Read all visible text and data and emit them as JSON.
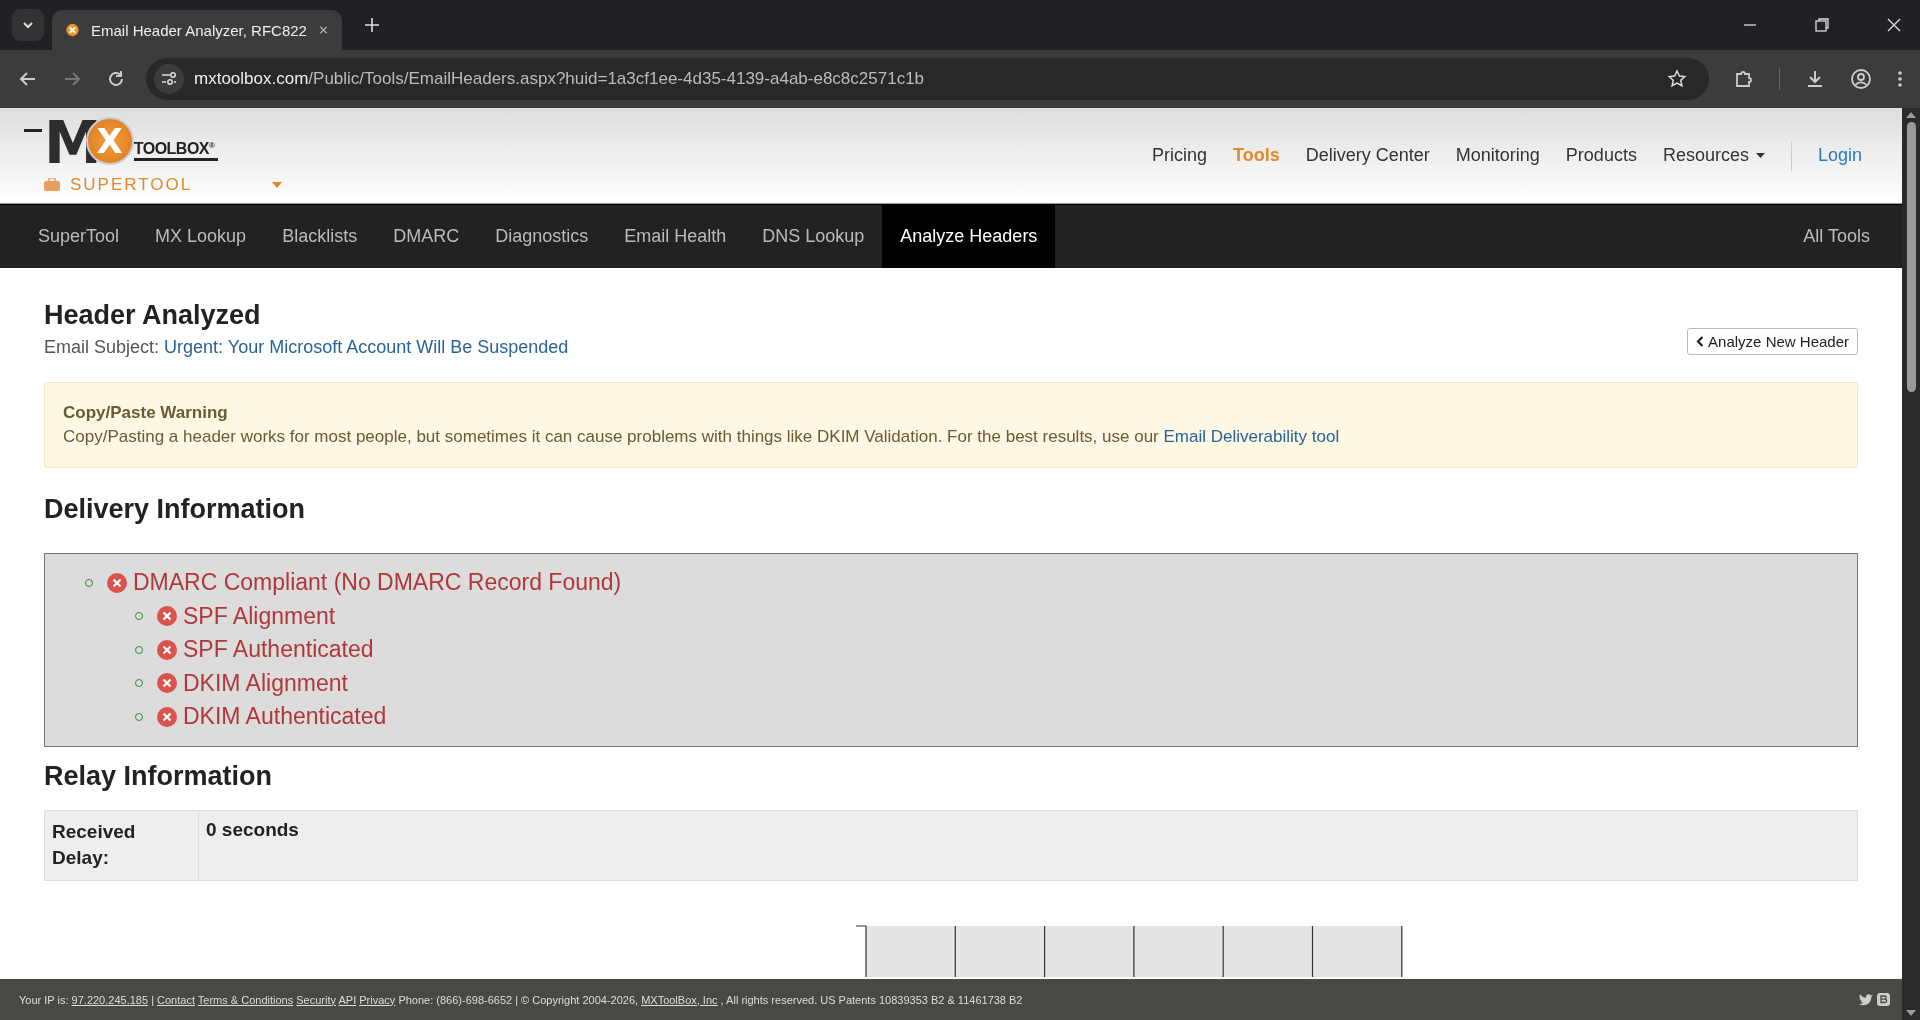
{
  "browser": {
    "tab": {
      "title": "Email Header Analyzer, RFC822",
      "selected": true
    },
    "url": {
      "host": "mxtoolbox.com",
      "path": "/Public/Tools/EmailHeaders.aspx?huid=1a3cf1ee-4d35-4139-a4ab-e8c8c2571c1b"
    }
  },
  "logo": {
    "first_letter": "M",
    "circle_letter": "X",
    "wordmark": "TOOLBOX$^{®}$",
    "product": "SUPERTOOL"
  },
  "header_menu": [
    {
      "label": "Pricing",
      "selected": false,
      "dropdown": false
    },
    {
      "label": "Tools",
      "selected": true,
      "dropdown": false
    },
    {
      "label": "Delivery Center",
      "selected": false,
      "dropdown": false
    },
    {
      "label": "Monitoring",
      "selected": false,
      "dropdown": false
    },
    {
      "label": "Products",
      "selected": false,
      "dropdown": false
    },
    {
      "label": "Resources",
      "selected": false,
      "dropdown": true
    }
  ],
  "login": "Login",
  "nav": [
    {
      "label": "SuperTool",
      "selected": false
    },
    {
      "label": "MX Lookup",
      "selected": false
    },
    {
      "label": "Blacklists",
      "selected": false
    },
    {
      "label": "DMARC",
      "selected": false
    },
    {
      "label": "Diagnostics",
      "selected": false
    },
    {
      "label": "Email Health",
      "selected": false
    },
    {
      "label": "DNS Lookup",
      "selected": false
    },
    {
      "label": "Analyze Headers",
      "selected": true
    }
  ],
  "nav_right": "All Tools",
  "title": "Header Analyzed",
  "subject": {
    "label": "Email Subject:",
    "value": "Urgent: Your Microsoft Account Will Be Suspended"
  },
  "analyze_button": "Analyze New Header",
  "warning": {
    "title": "Copy/Paste Warning",
    "text": "Copy/Pasting a header works for most people, but sometimes it can cause problems with things like DKIM Validation. For the best results, use our",
    "link": "Email Deliverability tool"
  },
  "delivery": {
    "title": "Delivery Information",
    "items": [
      {
        "label": "DMARC Compliant (No DMARC Record Found)",
        "passed": false,
        "children": [
          {
            "label": "SPF Alignment",
            "passed": false
          },
          {
            "label": "SPF Authenticated",
            "passed": false
          },
          {
            "label": "DKIM Alignment",
            "passed": false
          },
          {
            "label": "DKIM Authenticated",
            "passed": false
          }
        ]
      }
    ]
  },
  "relay": {
    "title": "Relay Information",
    "rows": [
      {
        "label": "Received Delay:",
        "value": "0 seconds"
      }
    ]
  },
  "footer": [
    {
      "kind": "text",
      "text": "Your IP is:"
    },
    {
      "kind": "link",
      "text": "97.220.245.185"
    },
    {
      "kind": "text",
      "text": "|"
    },
    {
      "kind": "link",
      "text": "Contact"
    },
    {
      "kind": "link",
      "text": "Terms & Conditions"
    },
    {
      "kind": "link",
      "text": "Security"
    },
    {
      "kind": "link",
      "text": "API"
    },
    {
      "kind": "link",
      "text": "Privacy"
    },
    {
      "kind": "text",
      "text": "Phone: (866)-698-6652 |"
    },
    {
      "kind": "text",
      "text": "© Copyright 2004-2026,"
    },
    {
      "kind": "link",
      "text": "MXToolBox, Inc"
    },
    {
      "kind": "text",
      "text": ", All rights reserved. US Patents 10839353 B2 & 11461738 B2"
    }
  ]
}
